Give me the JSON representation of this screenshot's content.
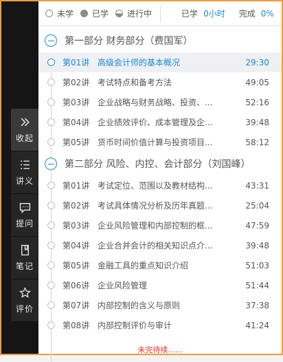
{
  "status": {
    "legend": [
      {
        "icon": "empty-circle-icon",
        "label": "未学"
      },
      {
        "icon": "filled-circle-icon",
        "label": "已学"
      },
      {
        "icon": "half-circle-icon",
        "label": "进行中"
      }
    ],
    "learned_label": "已学",
    "learned_value": "0小时",
    "done_label": "完成",
    "done_value": "0%"
  },
  "toolbar": [
    {
      "name": "collapse",
      "icon": "double-chevron-right-icon",
      "label": "收起"
    },
    {
      "name": "lecture",
      "icon": "list-icon",
      "label": "讲义"
    },
    {
      "name": "question",
      "icon": "comment-icon",
      "label": "提问"
    },
    {
      "name": "notes",
      "icon": "note-icon",
      "label": "笔记"
    },
    {
      "name": "rate",
      "icon": "star-icon",
      "label": "评价"
    }
  ],
  "sections": [
    {
      "title": "第一部分   财务部分（费国军）",
      "lectures": [
        {
          "no": "第01讲",
          "title": "高级会计师的基本概况",
          "duration": "29:30",
          "current": true
        },
        {
          "no": "第02讲",
          "title": "考试特点和备考方法",
          "duration": "49:05"
        },
        {
          "no": "第03讲",
          "title": "企业战略与财务战略、投资、...",
          "duration": "52:16"
        },
        {
          "no": "第04讲",
          "title": "企业绩效评价、成本管理及企...",
          "duration": "39:48"
        },
        {
          "no": "第05讲",
          "title": "货币时间价值计算与投资项目...",
          "duration": "58:12"
        }
      ]
    },
    {
      "title": "第二部分   风险、内控、会计部分（刘国峰）",
      "lectures": [
        {
          "no": "第01讲",
          "title": "考试定位、范围以及教材结构...",
          "duration": "43:31"
        },
        {
          "no": "第02讲",
          "title": "考试具体情况分析及历年真题...",
          "duration": "25:04"
        },
        {
          "no": "第03讲",
          "title": "企业风险管理和内部控制的框...",
          "duration": "47:59"
        },
        {
          "no": "第04讲",
          "title": "企业合并会计的相关知识点介...",
          "duration": "39:48"
        },
        {
          "no": "第05讲",
          "title": "金融工具的重点知识介绍",
          "duration": "51:03"
        },
        {
          "no": "第06讲",
          "title": "企业风险管理",
          "duration": "51:44"
        },
        {
          "no": "第07讲",
          "title": "内部控制的含义与原则",
          "duration": "37:38"
        },
        {
          "no": "第08讲",
          "title": "内部控制评价与审计",
          "duration": "41:24"
        }
      ]
    }
  ],
  "footer": "未完待续......",
  "colors": {
    "accent": "#1a8ad8",
    "frame": "#f29b38",
    "warning": "#e0302a"
  }
}
